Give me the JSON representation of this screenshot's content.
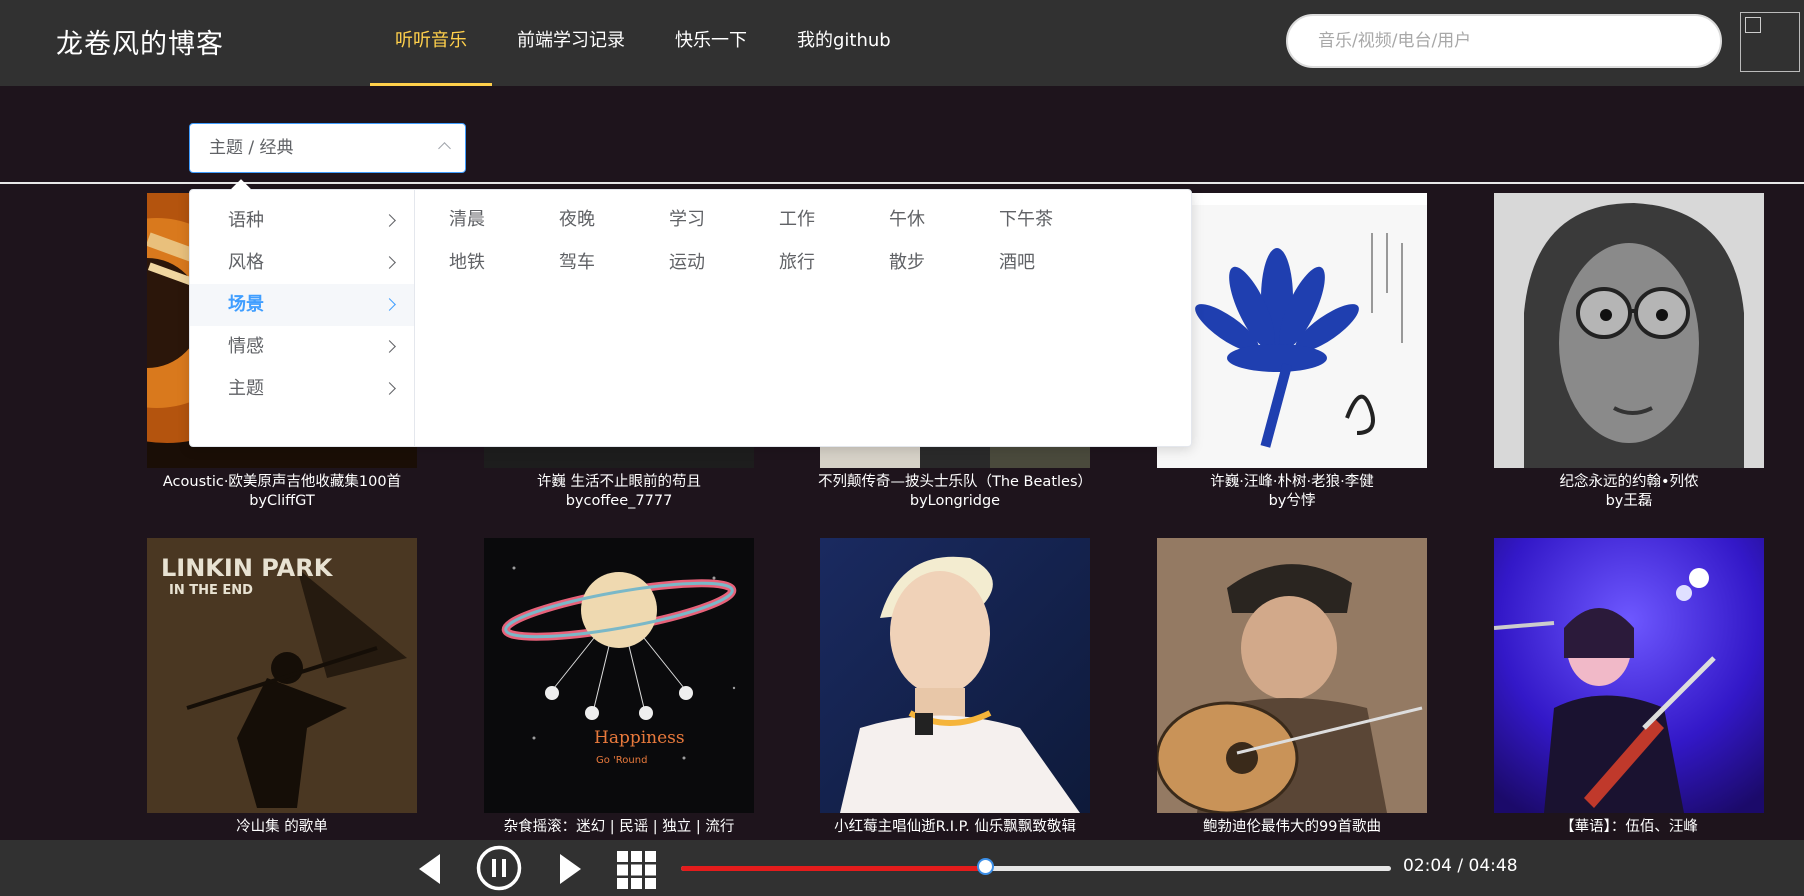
{
  "header": {
    "logo": "龙卷风的博客",
    "nav": [
      "听听音乐",
      "前端学习记录",
      "快乐一下",
      "我的github"
    ],
    "active_nav": "听听音乐",
    "search_placeholder": "音乐/视频/电台/用户"
  },
  "category_select": {
    "value": "主题 / 经典",
    "level1": [
      "语种",
      "风格",
      "场景",
      "情感",
      "主题"
    ],
    "active_level1": "场景",
    "level2": [
      "清晨",
      "夜晚",
      "学习",
      "工作",
      "午休",
      "下午茶",
      "地铁",
      "驾车",
      "运动",
      "旅行",
      "散步",
      "酒吧"
    ]
  },
  "playlists": [
    {
      "title": "Acoustic·欧美原声吉他收藏集100首",
      "by": "byCliffGT"
    },
    {
      "title": "许巍 生活不止眼前的苟且",
      "by": "bycoffee_7777"
    },
    {
      "title": "不列颠传奇—披头士乐队（The Beatles）",
      "by": "byLongridge"
    },
    {
      "title": "许巍·汪峰·朴树·老狼·李健",
      "by": "by兮悖"
    },
    {
      "title": "纪念永远的约翰•列侬",
      "by": "by王磊"
    },
    {
      "title": "冷山集 的歌单",
      "by": ""
    },
    {
      "title": "杂食摇滚：迷幻 | 民谣 | 独立 | 流行",
      "by": ""
    },
    {
      "title": "小红莓主唱仙逝R.I.P. 仙乐飘飘致敬辑",
      "by": ""
    },
    {
      "title": "鲍勃迪伦最伟大的99首歌曲",
      "by": ""
    },
    {
      "title": "【華语】：伍佰、汪峰",
      "by": ""
    }
  ],
  "cover_text": {
    "linkin_park_title": "LINKIN PARK",
    "linkin_park_subtitle": "IN THE END",
    "happiness": "Happiness",
    "go_round": "Go 'Round"
  },
  "player": {
    "current_time": "02:04",
    "total_time": "04:48",
    "time_display": "02:04 / 04:48",
    "progress": 0.43,
    "progress_color": "#e41c1c"
  },
  "colors": {
    "header_bg": "#313131",
    "page_bg": "#1e141c",
    "accent_nav": "#ffd04b",
    "select_accent": "#409eff"
  }
}
